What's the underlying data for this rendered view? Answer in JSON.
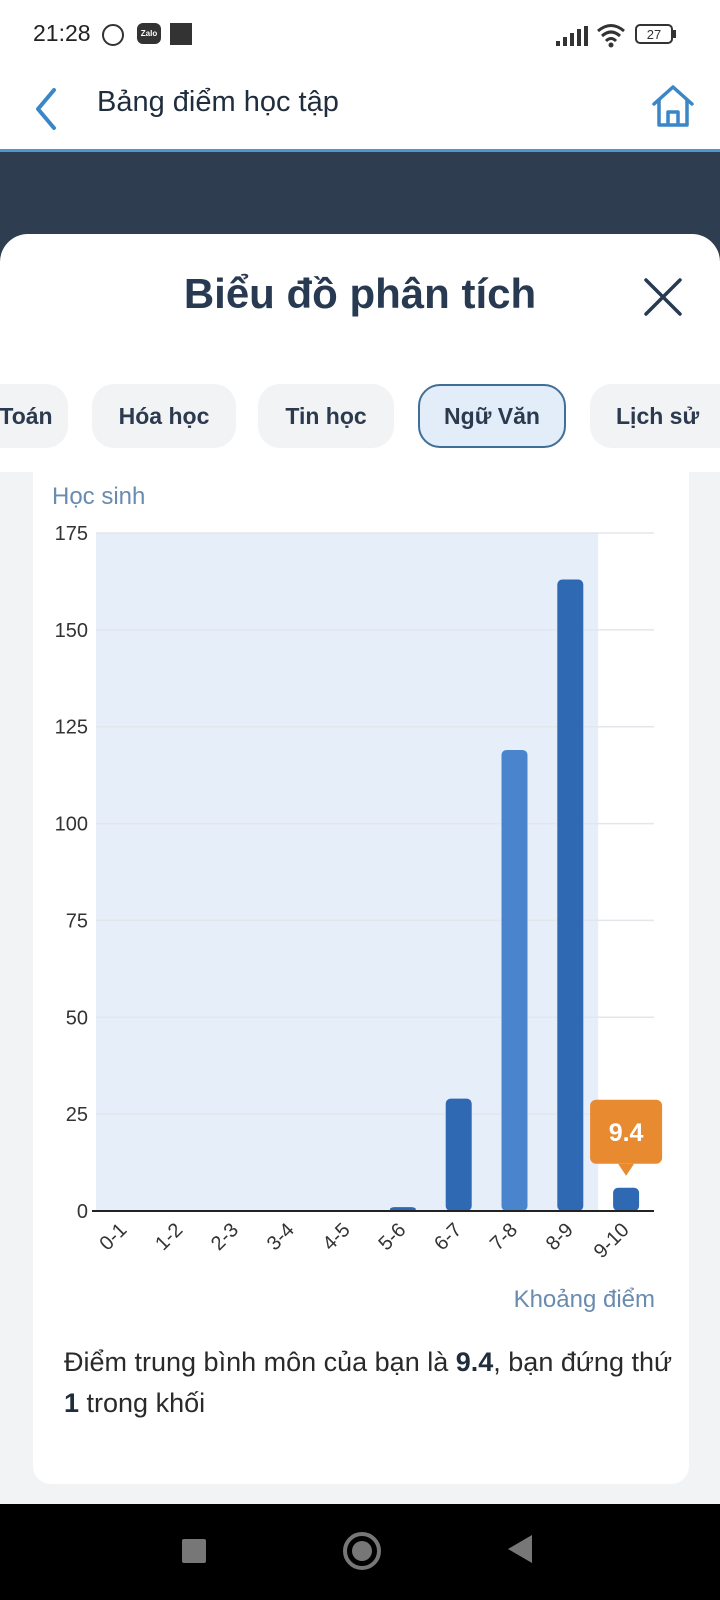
{
  "status_bar": {
    "time": "21:28",
    "battery": "27",
    "icons": [
      "alarm-icon",
      "zalo-icon",
      "notification-icon",
      "signal-icon",
      "wifi-icon",
      "battery-icon"
    ]
  },
  "header": {
    "title": "Bảng điểm học tập",
    "back_icon": "chevron-left-icon",
    "home_icon": "home-icon"
  },
  "sheet": {
    "title": "Biểu đồ phân tích",
    "close_icon": "close-icon"
  },
  "tabs": [
    {
      "label": "Toán"
    },
    {
      "label": "Hóa học"
    },
    {
      "label": "Tin học"
    },
    {
      "label": "Ngữ Văn",
      "active": true
    },
    {
      "label": "Lịch sử"
    }
  ],
  "chart_data": {
    "type": "bar",
    "ylabel": "Học sinh",
    "xlabel": "Khoảng điểm",
    "categories": [
      "0-1",
      "1-2",
      "2-3",
      "3-4",
      "4-5",
      "5-6",
      "6-7",
      "7-8",
      "8-9",
      "9-10"
    ],
    "values": [
      0,
      0,
      0,
      0,
      0,
      1,
      29,
      119,
      163,
      6
    ],
    "ylim": [
      0,
      175
    ],
    "yticks": [
      0,
      25,
      50,
      75,
      100,
      125,
      150,
      175
    ],
    "grid": true,
    "highlight_category": "9-10",
    "tooltip": "9.4",
    "colors": {
      "bar": "#2f68b3",
      "bar_highlight": "#4a84cc",
      "shaded_region": "#e6eefa",
      "tooltip": "#e88a30"
    }
  },
  "summary": {
    "prefix": "Điểm trung bình môn của bạn là ",
    "score": "9.4",
    "middle": ", bạn đứng thứ ",
    "rank": "1",
    "suffix": " trong khối"
  },
  "nav_bar": {
    "icons": [
      "recent-apps-icon",
      "home-circle-icon",
      "back-triangle-icon"
    ]
  }
}
